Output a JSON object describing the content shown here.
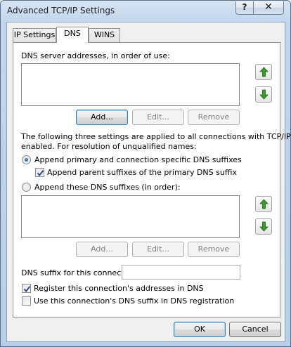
{
  "window": {
    "title": "Advanced TCP/IP Settings",
    "help_label": "?",
    "close_label": "✕"
  },
  "tabs": [
    {
      "label": "IP Settings",
      "active": false
    },
    {
      "label": "DNS",
      "active": true
    },
    {
      "label": "WINS",
      "active": false
    }
  ],
  "dns_servers": {
    "label": "DNS server addresses, in order of use:",
    "items": [],
    "add_label": "Add...",
    "edit_label": "Edit...",
    "remove_label": "Remove"
  },
  "resolution": {
    "description_line1": "The following three settings are applied to all connections with TCP/IP",
    "description_line2": "enabled. For resolution of unqualified names:",
    "option_primary_label": "Append primary and connection specific DNS suffixes",
    "option_primary_selected": true,
    "append_parent_label": "Append parent suffixes of the primary DNS suffix",
    "append_parent_checked": true,
    "option_these_label": "Append these DNS suffixes (in order):",
    "option_these_selected": false
  },
  "dns_suffixes": {
    "items": [],
    "add_label": "Add...",
    "edit_label": "Edit...",
    "remove_label": "Remove"
  },
  "connection_suffix": {
    "label": "DNS suffix for this connection:",
    "value": ""
  },
  "registration": {
    "register_label": "Register this connection's addresses in DNS",
    "register_checked": true,
    "use_suffix_label": "Use this connection's DNS suffix in DNS registration",
    "use_suffix_checked": false
  },
  "footer": {
    "ok_label": "OK",
    "cancel_label": "Cancel"
  },
  "colors": {
    "arrow_green": "#3a9a2c",
    "check_mark": "#2c4a86",
    "radio_dot": "#0d4a85"
  },
  "icons": {
    "up": "arrow-up-icon",
    "down": "arrow-down-icon"
  }
}
